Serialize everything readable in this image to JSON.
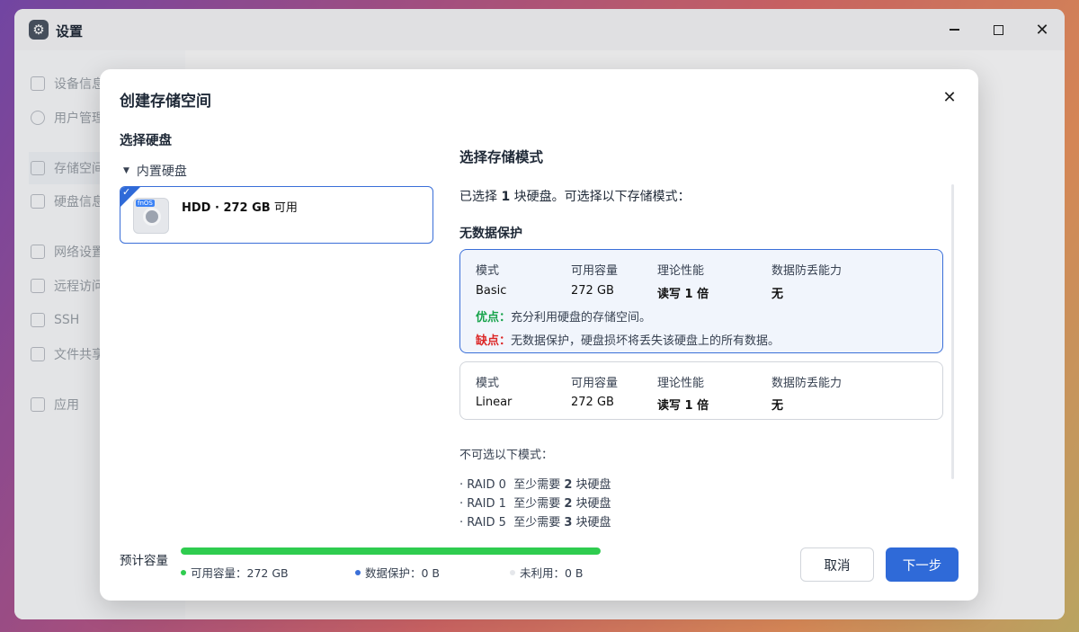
{
  "window": {
    "title": "设置"
  },
  "sidebar": {
    "items": [
      {
        "label": "设备信息"
      },
      {
        "label": "用户管理"
      },
      {
        "label": "存储空间"
      },
      {
        "label": "硬盘信息"
      },
      {
        "label": "网络设置"
      },
      {
        "label": "远程访问"
      },
      {
        "label": "SSH"
      },
      {
        "label": "文件共享"
      },
      {
        "label": "应用"
      }
    ]
  },
  "dialog": {
    "title": "创建存储空间",
    "close_icon": "✕",
    "left": {
      "heading": "选择硬盘",
      "group_label": "内置硬盘",
      "disk": {
        "name": "HDD · 272 GB",
        "status": "可用",
        "badge": "fnOS"
      }
    },
    "right": {
      "heading": "选择存储模式",
      "selected_prefix": "已选择 ",
      "selected_count": "1",
      "selected_suffix": " 块硬盘。可选择以下存储模式：",
      "section_heading": "无数据保护",
      "col_headers": [
        "模式",
        "可用容量",
        "理论性能",
        "数据防丢能力"
      ],
      "modes": [
        {
          "name": "Basic",
          "capacity": "272 GB",
          "performance": "读写 1 倍",
          "protection": "无",
          "pro_label": "优点：",
          "pro_text": "充分利用硬盘的存储空间。",
          "con_label": "缺点：",
          "con_text": "无数据保护，硬盘损坏将丢失该硬盘上的所有数据。"
        },
        {
          "name": "Linear",
          "capacity": "272 GB",
          "performance": "读写 1 倍",
          "protection": "无"
        }
      ],
      "unavailable_heading": "不可选以下模式：",
      "unavailable": [
        {
          "mode": "· RAID 0",
          "req_prefix": "至少需要 ",
          "req_count": "2",
          "req_suffix": " 块硬盘"
        },
        {
          "mode": "· RAID 1",
          "req_prefix": "至少需要 ",
          "req_count": "2",
          "req_suffix": " 块硬盘"
        },
        {
          "mode": "· RAID 5",
          "req_prefix": "至少需要 ",
          "req_count": "3",
          "req_suffix": " 块硬盘"
        }
      ]
    },
    "footer": {
      "estimate_label": "预计容量",
      "usage_fraction": 1.0,
      "legend": [
        {
          "label": "可用容量：272 GB",
          "color": "#2fcc4f"
        },
        {
          "label": "数据保护：0 B",
          "color": "#3a6fd8"
        },
        {
          "label": "未利用：0 B",
          "color": "#e5e7eb"
        }
      ],
      "cancel_label": "取消",
      "next_label": "下一步"
    }
  }
}
